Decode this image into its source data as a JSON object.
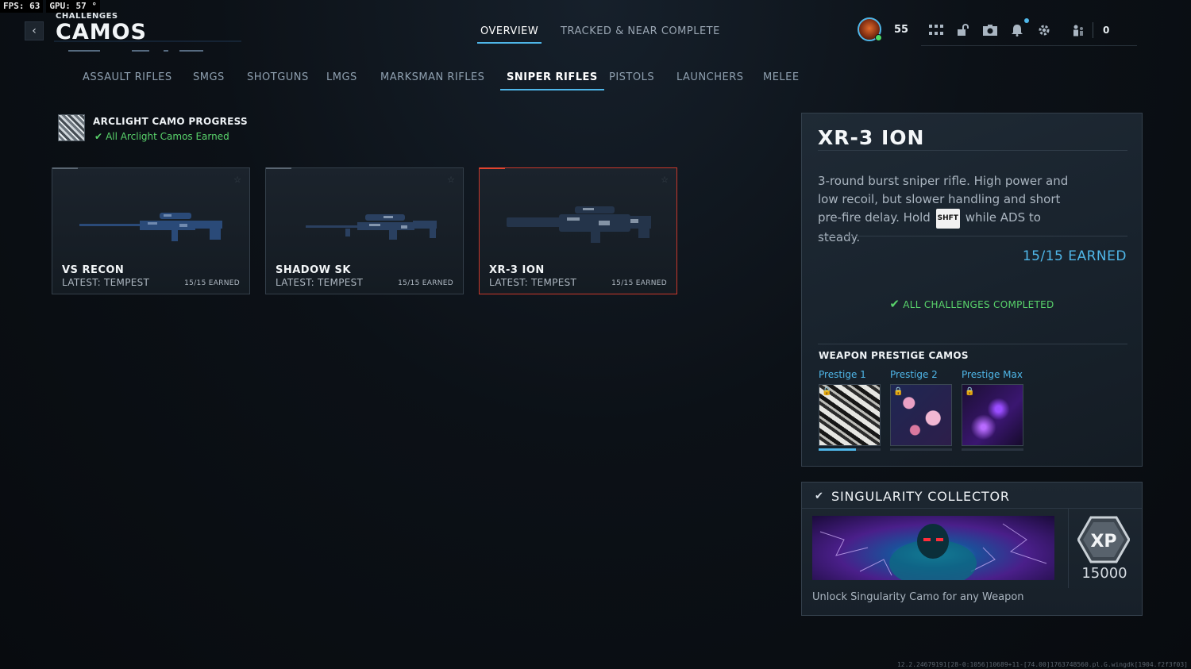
{
  "perf": {
    "fps_label": "FPS:",
    "fps_value": "63",
    "gpu_label": "GPU:",
    "gpu_value": "57 °"
  },
  "header": {
    "section": "CHALLENGES",
    "title": "CAMOS",
    "tabs": [
      {
        "label": "OVERVIEW",
        "active": true
      },
      {
        "label": "TRACKED & NEAR COMPLETE",
        "active": false
      }
    ]
  },
  "player": {
    "level": "55",
    "currency": "0"
  },
  "hud_icons": [
    "grid-icon",
    "unlock-icon",
    "camera-icon",
    "bell-icon",
    "gear-icon",
    "party-icon"
  ],
  "categories": [
    {
      "label": "ASSAULT RIFLES",
      "active": false
    },
    {
      "label": "SMGS",
      "active": false
    },
    {
      "label": "SHOTGUNS",
      "active": false
    },
    {
      "label": "LMGS",
      "active": false
    },
    {
      "label": "MARKSMAN RIFLES",
      "active": false
    },
    {
      "label": "SNIPER RIFLES",
      "active": true
    },
    {
      "label": "PISTOLS",
      "active": false
    },
    {
      "label": "LAUNCHERS",
      "active": false
    },
    {
      "label": "MELEE",
      "active": false
    }
  ],
  "arclight": {
    "title": "ARCLIGHT CAMO PROGRESS",
    "status": "All Arclight Camos Earned"
  },
  "weapons": [
    {
      "name": "VS RECON",
      "latest": "LATEST: TEMPEST",
      "earned": "15/15 EARNED",
      "selected": false
    },
    {
      "name": "SHADOW SK",
      "latest": "LATEST: TEMPEST",
      "earned": "15/15 EARNED",
      "selected": false
    },
    {
      "name": "XR-3 ION",
      "latest": "LATEST: TEMPEST",
      "earned": "15/15 EARNED",
      "selected": true
    }
  ],
  "detail": {
    "name": "XR-3 ION",
    "desc_part1": "3-round burst sniper rifle. High power and low recoil, but slower handling and short pre-fire delay. Hold",
    "key": "SHFT",
    "desc_part2": "while ADS to steady.",
    "earned": "15/15 EARNED",
    "complete": "ALL CHALLENGES COMPLETED",
    "prestige_title": "WEAPON PRESTIGE CAMOS",
    "prestige": [
      {
        "label": "Prestige 1",
        "locked": true,
        "progress": 0.6
      },
      {
        "label": "Prestige 2",
        "locked": true,
        "progress": 0
      },
      {
        "label": "Prestige Max",
        "locked": true,
        "progress": 0
      }
    ]
  },
  "reward": {
    "title": "SINGULARITY COLLECTOR",
    "xp_label": "XP",
    "xp_amount": "15000",
    "desc": "Unlock Singularity Camo for any Weapon"
  },
  "build_info": "12.2.24679191[28-0:1056]10689+11-[74.00]1763748560.pl.G.wingdk[1904.f2f3f03]",
  "colors": {
    "accent": "#4fb6e8",
    "success": "#59d36b",
    "selected_border": "#c8382b"
  }
}
